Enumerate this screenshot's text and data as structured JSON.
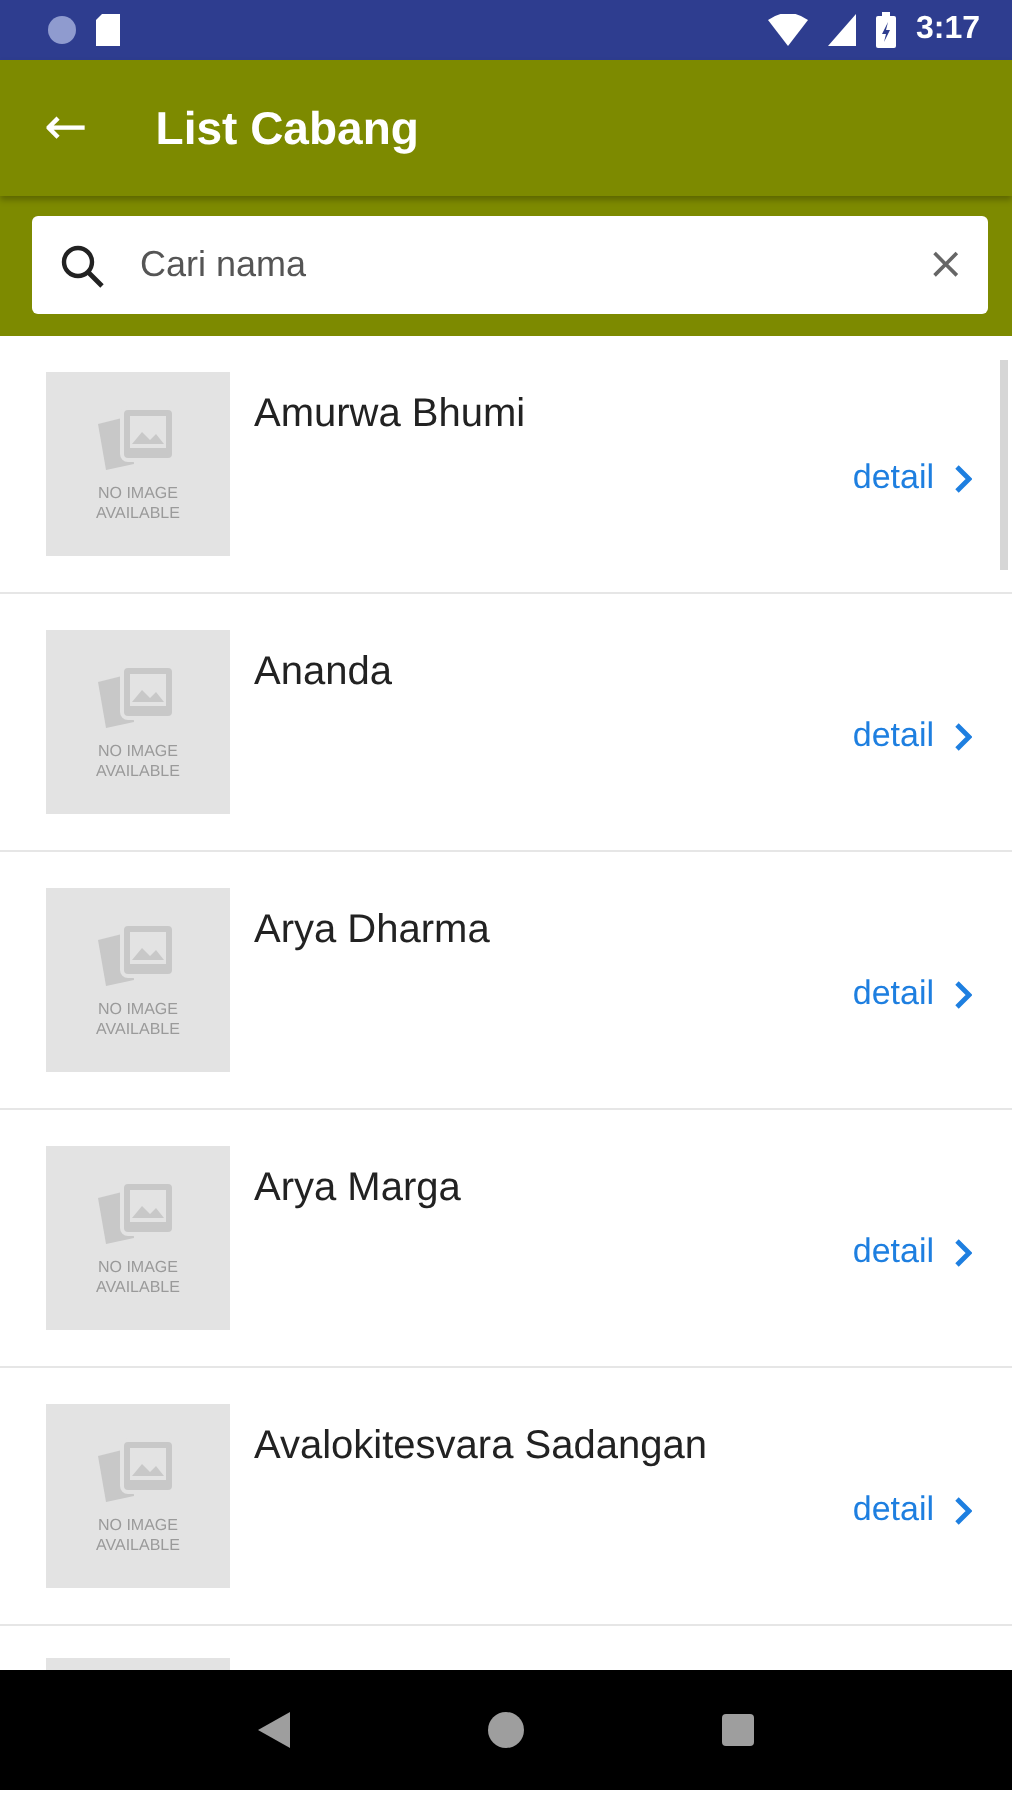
{
  "status_bar": {
    "time": "3:17"
  },
  "app_bar": {
    "back": "←",
    "title": "List Cabang"
  },
  "search": {
    "placeholder": "Cari nama",
    "clear": "×"
  },
  "branches": [
    {
      "kind": "full",
      "name": "Amurwa Bhumi",
      "image_text": "NO IMAGE AVAILABLE",
      "link": "detail"
    },
    {
      "kind": "full",
      "name": "Ananda",
      "image_text": "NO IMAGE AVAILABLE",
      "link": "detail"
    },
    {
      "kind": "full",
      "name": "Arya Dharma",
      "image_text": "NO IMAGE AVAILABLE",
      "link": "detail"
    },
    {
      "kind": "full",
      "name": "Arya Marga",
      "image_text": "NO IMAGE AVAILABLE",
      "link": "detail"
    },
    {
      "kind": "full",
      "name": "Avalokitesvara Sadangan",
      "image_text": "NO IMAGE AVAILABLE",
      "link": "detail"
    },
    {
      "kind": "cut"
    }
  ]
}
